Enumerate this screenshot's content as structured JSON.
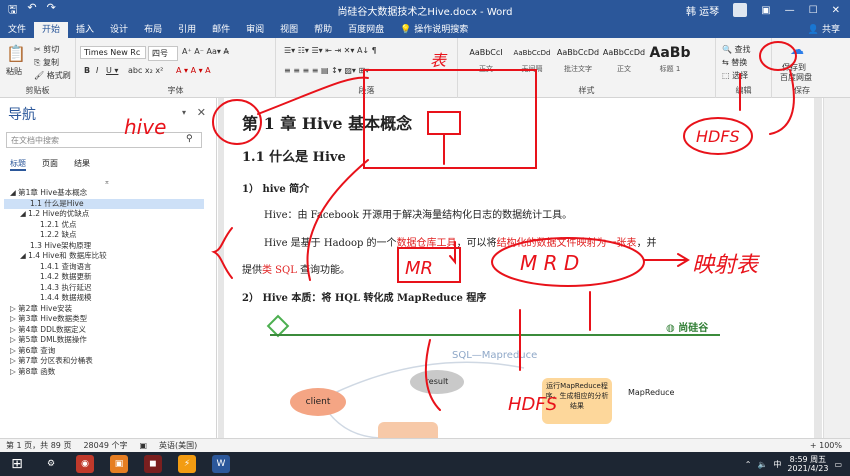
{
  "window": {
    "title": "尚硅谷大数据技术之Hive.docx  -  Word",
    "user": "韩 运琴"
  },
  "quick_access": {
    "save_icon": "save-icon",
    "undo_icon": "undo-icon",
    "redo_icon": "redo-icon"
  },
  "tabs": [
    "文件",
    "开始",
    "插入",
    "设计",
    "布局",
    "引用",
    "邮件",
    "审阅",
    "视图",
    "帮助",
    "百度网盘",
    "操作说明搜索"
  ],
  "share_label": "共享",
  "ribbon": {
    "clipboard": {
      "paste": "粘贴",
      "cut": "剪切",
      "copy": "复制",
      "format_painter": "格式刷",
      "label": "剪贴板"
    },
    "font": {
      "family": "Times New Rc",
      "size": "四号",
      "label": "字体"
    },
    "paragraph": {
      "label": "段落"
    },
    "styles": {
      "label": "样式",
      "items": [
        {
          "preview": "AaBbCcI",
          "name": "正文"
        },
        {
          "preview": "AaBbCcDd",
          "name": "无间隔"
        },
        {
          "preview": "AaBbCcDd",
          "name": "批注文字"
        },
        {
          "preview": "AaBbCcDd",
          "name": "正文"
        },
        {
          "preview": "AaBb",
          "name": "标题 1"
        }
      ]
    },
    "editing": {
      "find": "查找",
      "replace": "替换",
      "select": "选择",
      "label": "编辑"
    },
    "save": {
      "label1": "保存到",
      "label2": "百度网盘",
      "group": "保存"
    }
  },
  "nav": {
    "title": "导航",
    "search_placeholder": "在文档中搜索",
    "tabs": [
      "标题",
      "页面",
      "结果"
    ],
    "items": [
      {
        "text": "◢  第1章 Hive基本概念",
        "indent": 0,
        "selected": false
      },
      {
        "text": "1.1 什么是Hive",
        "indent": 2,
        "selected": true
      },
      {
        "text": "◢  1.2 Hive的优缺点",
        "indent": 1,
        "selected": false
      },
      {
        "text": "1.2.1 优点",
        "indent": 3,
        "selected": false
      },
      {
        "text": "1.2.2 缺点",
        "indent": 3,
        "selected": false
      },
      {
        "text": "1.3 Hive架构原理",
        "indent": 2,
        "selected": false
      },
      {
        "text": "◢  1.4 Hive和 数据库比较",
        "indent": 1,
        "selected": false
      },
      {
        "text": "1.4.1 查询语言",
        "indent": 3,
        "selected": false
      },
      {
        "text": "1.4.2 数据更新",
        "indent": 3,
        "selected": false
      },
      {
        "text": "1.4.3 执行延迟",
        "indent": 3,
        "selected": false
      },
      {
        "text": "1.4.4 数据规模",
        "indent": 3,
        "selected": false
      },
      {
        "text": "▷  第2章 Hive安装",
        "indent": 0,
        "selected": false
      },
      {
        "text": "▷  第3章 Hive数据类型",
        "indent": 0,
        "selected": false
      },
      {
        "text": "▷  第4章 DDL数据定义",
        "indent": 0,
        "selected": false
      },
      {
        "text": "▷  第5章 DML数据操作",
        "indent": 0,
        "selected": false
      },
      {
        "text": "▷  第6章 查询",
        "indent": 0,
        "selected": false
      },
      {
        "text": "▷  第7章 分区表和分桶表",
        "indent": 0,
        "selected": false
      },
      {
        "text": "▷  第8章 函数",
        "indent": 0,
        "selected": false
      }
    ]
  },
  "doc": {
    "h1": "第 1 章  Hive 基本概念",
    "h2": "1.1  什么是 Hive",
    "s1": "1）  hive 简介",
    "p1": "Hive：由 Facebook 开源用于解决海量结构化日志的数据统计工具。",
    "p2a": "Hive 是基于 Hadoop 的一个",
    "p2b": "数据仓库工具",
    "p2c": "，可以将",
    "p2d": "结构化的数据文件映射为一张表",
    "p2e": "，并",
    "p3a": "提供",
    "p3b": "类 SQL",
    "p3c": " 查询功能。",
    "s2": "2）  Hive 本质：将 HQL 转化成 MapReduce 程序",
    "logo": "尚硅谷",
    "diagram_title": "SQL—Mapreduce",
    "client": "client",
    "result": "result",
    "mr_box": "运行MapReduce程序，生成相应的分析结果",
    "mr_label": "MapReduce"
  },
  "status": {
    "page": "第 1 页，共 89 页",
    "words": "28049 个字",
    "lang": "英语(美国)",
    "zoom": "+ 100%"
  },
  "taskbar": {
    "time": "8:59 周五",
    "date": "2021/4/23",
    "ime": "中"
  },
  "annotations": {
    "a1": "hive",
    "a2": "MR",
    "a3": "M R D",
    "a4": "映射表",
    "a5": "表",
    "a6": "HDFS",
    "a7": "HDFS"
  }
}
